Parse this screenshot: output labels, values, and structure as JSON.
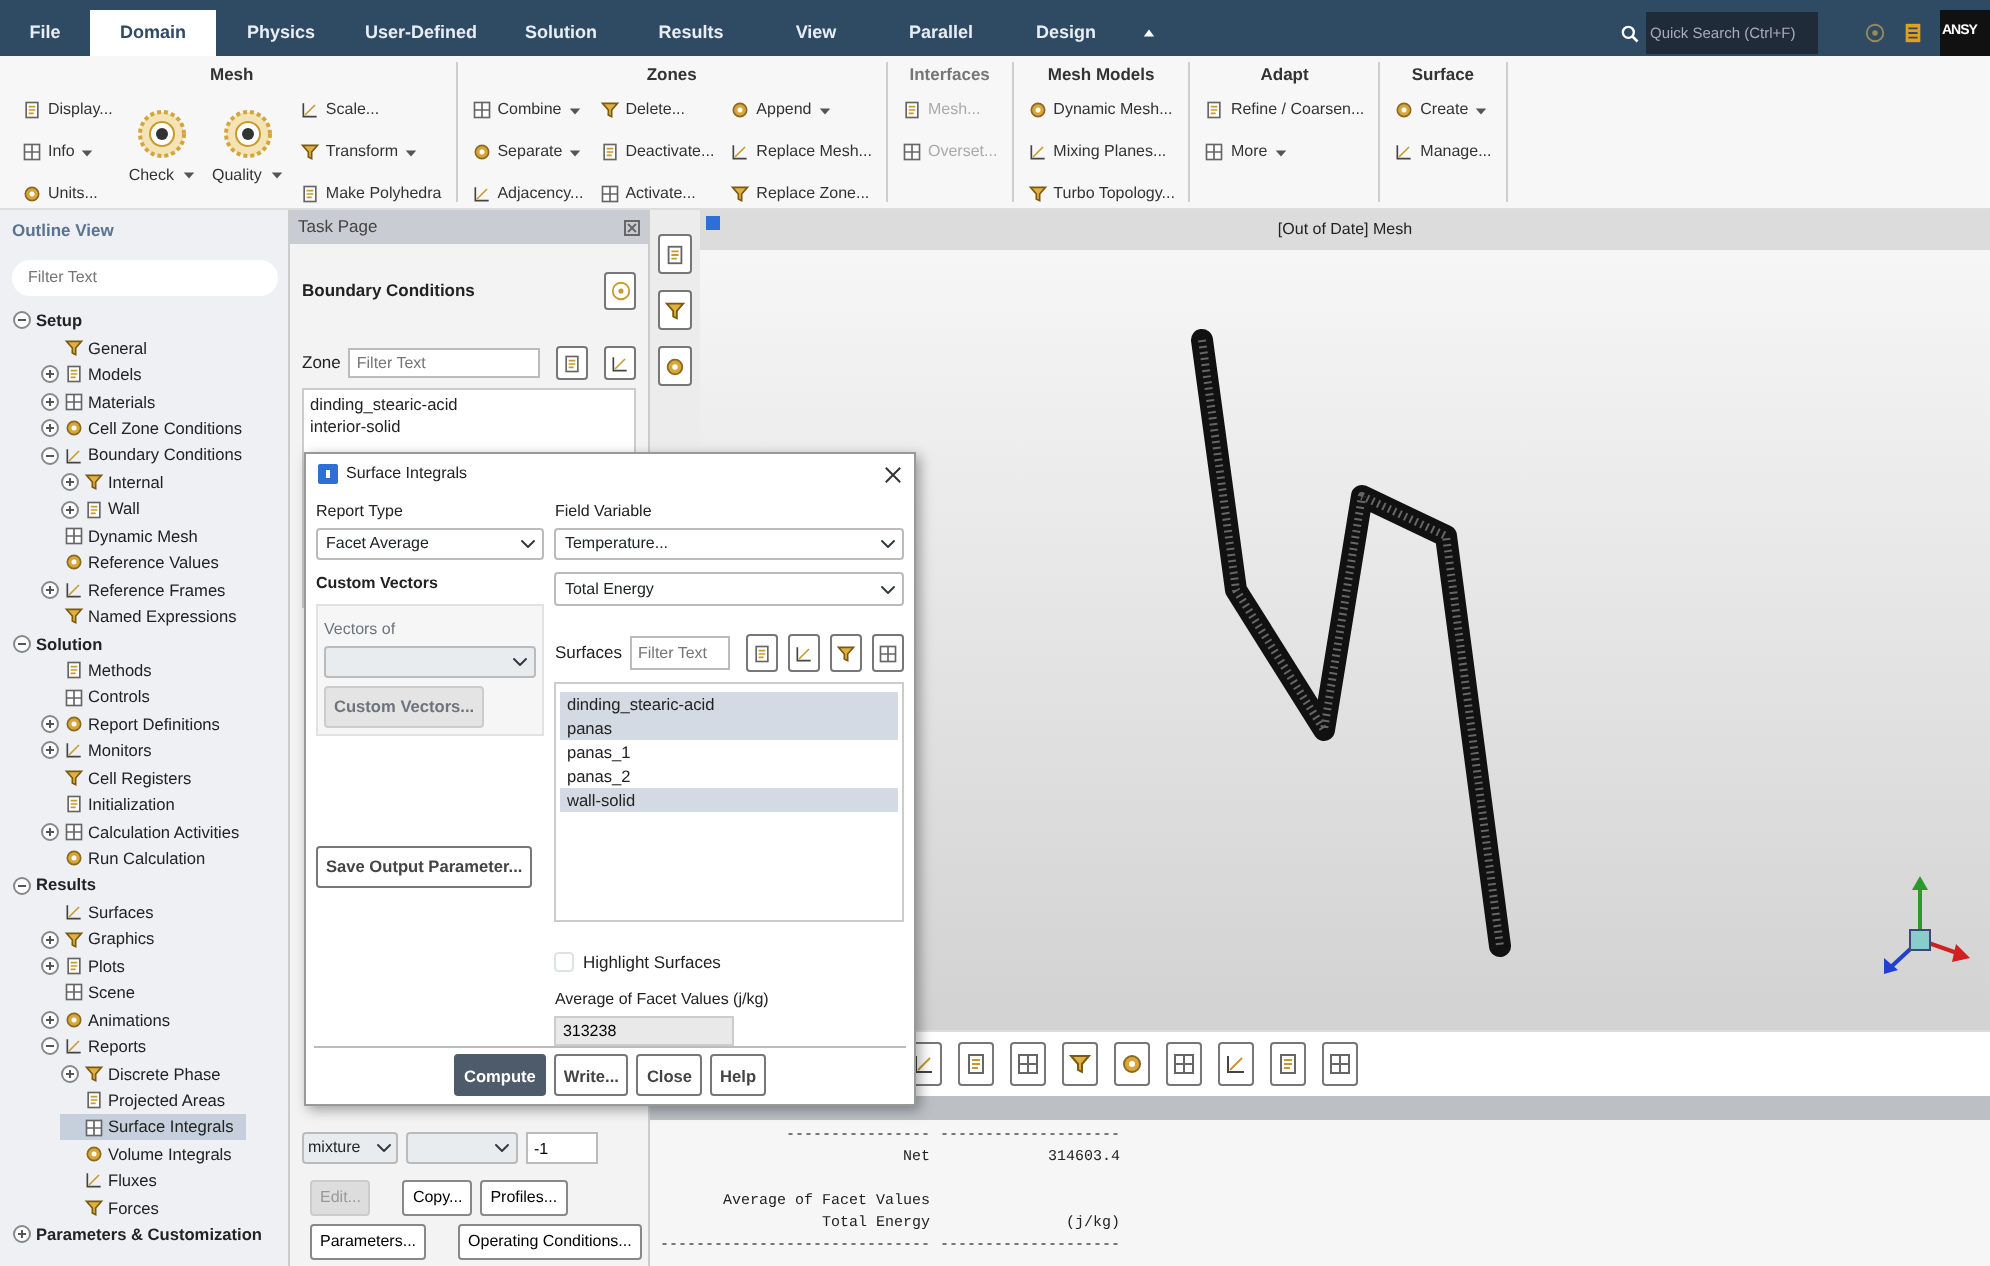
{
  "menu_tabs": [
    {
      "label": "File",
      "selected": false
    },
    {
      "label": "Domain",
      "selected": true
    },
    {
      "label": "Physics",
      "selected": false
    },
    {
      "label": "User-Defined",
      "selected": false
    },
    {
      "label": "Solution",
      "selected": false
    },
    {
      "label": "Results",
      "selected": false
    },
    {
      "label": "View",
      "selected": false
    },
    {
      "label": "Parallel",
      "selected": false
    },
    {
      "label": "Design",
      "selected": false
    }
  ],
  "quick_search": {
    "placeholder": "Quick Search (Ctrl+F)"
  },
  "brand": "ANSY",
  "ribbon": [
    {
      "title": "Mesh",
      "disabled": false,
      "columns": [
        [
          {
            "label": "Display...",
            "kind": "small",
            "dropdown": false
          },
          {
            "label": "Info",
            "kind": "small",
            "dropdown": true
          },
          {
            "label": "Units...",
            "kind": "small",
            "dropdown": false
          }
        ],
        [
          {
            "label": "Check",
            "kind": "big",
            "dropdown": true
          }
        ],
        [
          {
            "label": "Quality",
            "kind": "big",
            "dropdown": true
          }
        ],
        [
          {
            "label": "Scale...",
            "kind": "small",
            "dropdown": false
          },
          {
            "label": "Transform",
            "kind": "small",
            "dropdown": true
          },
          {
            "label": "Make Polyhedra",
            "kind": "small",
            "dropdown": false
          }
        ]
      ]
    },
    {
      "title": "Zones",
      "disabled": false,
      "columns": [
        [
          {
            "label": "Combine",
            "kind": "small",
            "dropdown": true
          },
          {
            "label": "Separate",
            "kind": "small",
            "dropdown": true
          },
          {
            "label": "Adjacency...",
            "kind": "small",
            "dropdown": false
          }
        ],
        [
          {
            "label": "Delete...",
            "kind": "small",
            "dropdown": false
          },
          {
            "label": "Deactivate...",
            "kind": "small",
            "dropdown": false
          },
          {
            "label": "Activate...",
            "kind": "small",
            "dropdown": false
          }
        ],
        [
          {
            "label": "Append",
            "kind": "small",
            "dropdown": true
          },
          {
            "label": "Replace Mesh...",
            "kind": "small",
            "dropdown": false
          },
          {
            "label": "Replace Zone...",
            "kind": "small",
            "dropdown": false
          }
        ]
      ]
    },
    {
      "title": "Interfaces",
      "disabled": true,
      "columns": [
        [
          {
            "label": "Mesh...",
            "kind": "small",
            "dropdown": false
          },
          {
            "label": "Overset...",
            "kind": "small",
            "dropdown": false
          }
        ]
      ]
    },
    {
      "title": "Mesh Models",
      "disabled": false,
      "columns": [
        [
          {
            "label": "Dynamic Mesh...",
            "kind": "small",
            "dropdown": false
          },
          {
            "label": "Mixing Planes...",
            "kind": "small",
            "dropdown": false
          },
          {
            "label": "Turbo Topology...",
            "kind": "small",
            "dropdown": false
          }
        ]
      ]
    },
    {
      "title": "Adapt",
      "disabled": false,
      "columns": [
        [
          {
            "label": "Refine / Coarsen...",
            "kind": "small",
            "dropdown": false
          },
          {
            "label": "More",
            "kind": "small",
            "dropdown": true
          }
        ]
      ]
    },
    {
      "title": "Surface",
      "disabled": false,
      "columns": [
        [
          {
            "label": "Create",
            "kind": "small",
            "dropdown": true
          },
          {
            "label": "Manage...",
            "kind": "small",
            "dropdown": false
          }
        ]
      ]
    }
  ],
  "outline": {
    "title": "Outline View",
    "filter": {
      "placeholder": "Filter Text"
    },
    "tree": [
      {
        "label": "Setup",
        "expanded": true,
        "selected": false,
        "children": [
          {
            "label": "General",
            "selected": false
          },
          {
            "label": "Models",
            "expanded": false,
            "selected": false
          },
          {
            "label": "Materials",
            "expanded": false,
            "selected": false
          },
          {
            "label": "Cell Zone Conditions",
            "expanded": false,
            "selected": false
          },
          {
            "label": "Boundary Conditions",
            "expanded": true,
            "selected": false,
            "children": [
              {
                "label": "Internal",
                "expanded": false,
                "selected": false
              },
              {
                "label": "Wall",
                "expanded": false,
                "selected": false
              }
            ]
          },
          {
            "label": "Dynamic Mesh",
            "selected": false
          },
          {
            "label": "Reference Values",
            "selected": false
          },
          {
            "label": "Reference Frames",
            "expanded": false,
            "selected": false
          },
          {
            "label": "Named Expressions",
            "selected": false
          }
        ]
      },
      {
        "label": "Solution",
        "expanded": true,
        "selected": false,
        "children": [
          {
            "label": "Methods",
            "selected": false
          },
          {
            "label": "Controls",
            "selected": false
          },
          {
            "label": "Report Definitions",
            "expanded": false,
            "selected": false
          },
          {
            "label": "Monitors",
            "expanded": false,
            "selected": false
          },
          {
            "label": "Cell Registers",
            "selected": false
          },
          {
            "label": "Initialization",
            "selected": false
          },
          {
            "label": "Calculation Activities",
            "expanded": false,
            "selected": false
          },
          {
            "label": "Run Calculation",
            "selected": false
          }
        ]
      },
      {
        "label": "Results",
        "expanded": true,
        "selected": false,
        "children": [
          {
            "label": "Surfaces",
            "selected": false
          },
          {
            "label": "Graphics",
            "expanded": false,
            "selected": false
          },
          {
            "label": "Plots",
            "expanded": false,
            "selected": false
          },
          {
            "label": "Scene",
            "selected": false
          },
          {
            "label": "Animations",
            "expanded": false,
            "selected": false
          },
          {
            "label": "Reports",
            "expanded": true,
            "selected": false,
            "children": [
              {
                "label": "Discrete Phase",
                "expanded": false,
                "selected": false
              },
              {
                "label": "Projected Areas",
                "selected": false
              },
              {
                "label": "Surface Integrals",
                "selected": true
              },
              {
                "label": "Volume Integrals",
                "selected": false
              },
              {
                "label": "Fluxes",
                "selected": false
              },
              {
                "label": "Forces",
                "selected": false
              }
            ]
          }
        ]
      },
      {
        "label": "Parameters & Customization",
        "expanded": false,
        "selected": false
      }
    ]
  },
  "task_page": {
    "title": "Task Page",
    "heading": "Boundary Conditions",
    "zone_label": "Zone",
    "zone_filter": {
      "placeholder": "Filter Text"
    },
    "zones": [
      {
        "label": "dinding_stearic-acid",
        "selected": false
      },
      {
        "label": "interior-solid",
        "selected": false
      }
    ],
    "phase": "mixture",
    "id_field": "-1",
    "button_rows": [
      [
        {
          "label": "Edit...",
          "disabled": true
        },
        {
          "label": "Copy...",
          "disabled": false
        },
        {
          "label": "Profiles...",
          "disabled": false
        }
      ],
      [
        {
          "label": "Parameters...",
          "disabled": false
        },
        {
          "label": "Operating Conditions...",
          "disabled": false
        }
      ]
    ]
  },
  "viewport": {
    "title": "[Out of Date] Mesh"
  },
  "dialog": {
    "title": "Surface Integrals",
    "report_type_label": "Report Type",
    "report_type": "Facet Average",
    "custom_vectors_label": "Custom Vectors",
    "vectors_of_label": "Vectors of",
    "custom_vectors_button": {
      "label": "Custom Vectors...",
      "disabled": true
    },
    "save_button": "Save Output Parameter...",
    "field_variable_label": "Field Variable",
    "field_variable": "Temperature...",
    "field_variable_sub": "Total Energy",
    "surfaces_label": "Surfaces",
    "surfaces_filter": {
      "placeholder": "Filter Text"
    },
    "surfaces": [
      {
        "label": "dinding_stearic-acid",
        "selected": true
      },
      {
        "label": "panas",
        "selected": true
      },
      {
        "label": "panas_1",
        "selected": false
      },
      {
        "label": "panas_2",
        "selected": false
      },
      {
        "label": "wall-solid",
        "selected": true
      }
    ],
    "highlight_surfaces": {
      "label": "Highlight Surfaces",
      "checked": false
    },
    "result_label": "Average of Facet Values (j/kg)",
    "result_value": "313238",
    "buttons": [
      {
        "label": "Compute",
        "primary": true
      },
      {
        "label": "Write...",
        "primary": false
      },
      {
        "label": "Close",
        "primary": false
      },
      {
        "label": "Help",
        "primary": false
      }
    ]
  },
  "console": {
    "lines": [
      {
        "cells": [
          "----------------",
          "--------------------"
        ]
      },
      {
        "cells": [
          "Net",
          "314603.4"
        ]
      },
      {
        "cells": [
          "Average of Facet Values"
        ]
      },
      {
        "cells": [
          "Total Energy",
          "(j/kg)"
        ]
      },
      {
        "cells": [
          "------------------------------",
          "--------------------"
        ]
      }
    ]
  }
}
